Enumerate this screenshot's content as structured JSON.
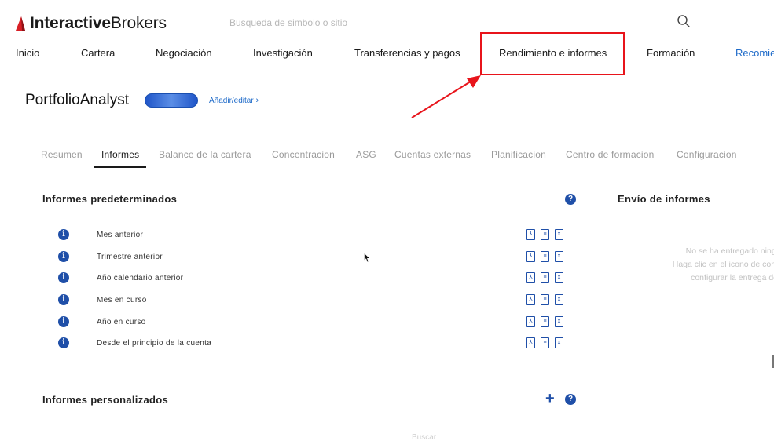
{
  "brand": {
    "name_bold": "Interactive",
    "name_thin": "Brokers",
    "logo_color": "#d81f26"
  },
  "search": {
    "placeholder": "Busqueda de simbolo o sitio"
  },
  "main_nav": [
    {
      "label": "Inicio"
    },
    {
      "label": "Cartera"
    },
    {
      "label": "Negociación"
    },
    {
      "label": "Investigación"
    },
    {
      "label": "Transferencias y pagos"
    },
    {
      "label": "Rendimiento e informes"
    },
    {
      "label": "Formación"
    },
    {
      "label": "Recomie"
    }
  ],
  "page": {
    "title": "PortfolioAnalyst",
    "add_edit_label": "Añadir/editar"
  },
  "sub_tabs": [
    {
      "label": "Resumen"
    },
    {
      "label": "Informes"
    },
    {
      "label": "Balance de la cartera"
    },
    {
      "label": "Concentracion"
    },
    {
      "label": "ASG"
    },
    {
      "label": "Cuentas externas"
    },
    {
      "label": "Planificacion"
    },
    {
      "label": "Centro de formacion"
    },
    {
      "label": "Configuracion"
    }
  ],
  "default_reports": {
    "title": "Informes predeterminados",
    "items": [
      {
        "label": "Mes anterior"
      },
      {
        "label": "Trimestre anterior"
      },
      {
        "label": "Año calendario anterior"
      },
      {
        "label": "Mes en curso"
      },
      {
        "label": "Año en curso"
      },
      {
        "label": "Desde el principio de la cuenta"
      }
    ]
  },
  "custom_reports": {
    "title": "Informes personalizados"
  },
  "distribution": {
    "title": "Envío de informes",
    "lines": [
      "No se ha entregado ningi",
      "Haga clic en el icono de conf",
      "configurar la entrega de"
    ]
  },
  "bottom": {
    "search_label": "Buscar"
  },
  "colors": {
    "accent": "#1f6bc9",
    "icon_blue": "#1f4fa8",
    "highlight_red": "#e8141b"
  }
}
